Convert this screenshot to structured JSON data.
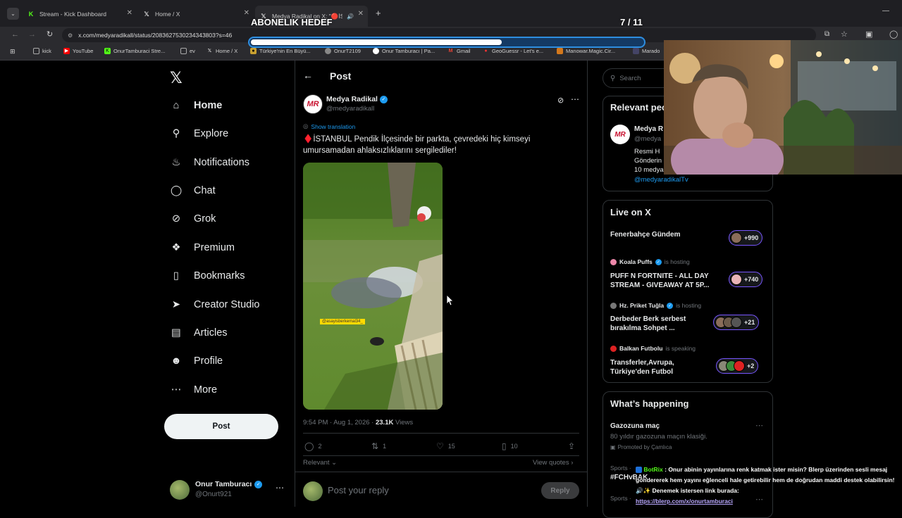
{
  "browser": {
    "tabs": [
      {
        "label": "Stream - Kick Dashboard",
        "icon": "kick-icon",
        "color": "#53fc18"
      },
      {
        "label": "Home / X",
        "icon": "x-logo-icon",
        "color": "#ffffff"
      },
      {
        "label": "Medya Radikal on X: \"🔴İST",
        "icon": "x-logo-icon",
        "color": "#ffffff"
      }
    ],
    "url": "x.com/medyaradikall/status/2083627530234343803?s=46",
    "bookmarks": [
      "kick",
      "YouTube",
      "OnurTamburaci Stre...",
      "ev",
      "Home / X",
      "Türkiye'nin En Büyü...",
      "OnurT2109",
      "Onur Tamburacı | Pa...",
      "Gmail",
      "GeoGuessr - Let's e...",
      "Manowar.Magic.Cir...",
      "Marado"
    ]
  },
  "overlay": {
    "goal_label": "ABONELIK HEDEF",
    "goal_count": "7 / 11",
    "goal_progress": 0.64
  },
  "nav": {
    "items": [
      {
        "label": "Home",
        "icon": "home-icon"
      },
      {
        "label": "Explore",
        "icon": "search-icon"
      },
      {
        "label": "Notifications",
        "icon": "bell-icon"
      },
      {
        "label": "Chat",
        "icon": "chat-icon"
      },
      {
        "label": "Grok",
        "icon": "grok-icon"
      },
      {
        "label": "Premium",
        "icon": "premium-icon"
      },
      {
        "label": "Bookmarks",
        "icon": "bookmark-icon"
      },
      {
        "label": "Creator Studio",
        "icon": "rocket-icon"
      },
      {
        "label": "Articles",
        "icon": "article-icon"
      },
      {
        "label": "Profile",
        "icon": "person-icon"
      },
      {
        "label": "More",
        "icon": "more-circle-icon"
      }
    ],
    "post_button": "Post",
    "account": {
      "name": "Onur Tamburacı",
      "handle": "@Onurt921"
    }
  },
  "main": {
    "header_title": "Post",
    "author": {
      "name": "Medya Radikal",
      "handle": "@medyaradikall",
      "avatar_text": "MR"
    },
    "show_translation": "Show translation",
    "text": "♦️İSTANBUL Pendik İlçesinde bir parkta, çevredeki hiç kimseyi umursamadan ahlaksızlıklarını sergilediler!",
    "media_watermark": "@asayisberkemal34_",
    "timestamp": "9:54 PM · Aug 1, 2026 · ",
    "views_count": "23.1K",
    "views_label": " Views",
    "stats": {
      "replies": "2",
      "reposts": "1",
      "likes": "15",
      "bookmarks": "10"
    },
    "relevant": "Relevant",
    "view_quotes": "View quotes",
    "reply_placeholder": "Post your reply",
    "reply_button": "Reply"
  },
  "right": {
    "search_placeholder": "Search",
    "relevant_title": "Relevant people",
    "relevant_person": {
      "name": "Medya R",
      "handle": "@medya",
      "bio_lines": [
        "Resmi H",
        "Gönderin",
        "10 medya"
      ],
      "link": "@medyaradikalTv"
    },
    "live_title": "Live on X",
    "live": [
      {
        "host": "",
        "status": "",
        "title": "Fenerbahçe Gündem",
        "count": "+990"
      },
      {
        "host": "Koala Puffs",
        "status": "is hosting",
        "title": "PUFF N FORTNITE - ALL DAY STREAM - GIVEAWAY AT 5P...",
        "count": "+740"
      },
      {
        "host": "Hz. Priket Tuğla",
        "status": "is hosting",
        "title": "Derbeder Berk serbest bırakılma Sohpet ...",
        "count": "+21"
      },
      {
        "host": "Balkan Futbolu",
        "status": "is speaking",
        "title": "Transferler,Avrupa, Türkiye'den Futbol",
        "count": "+2"
      }
    ],
    "happening_title": "What’s happening",
    "trend": {
      "title": "Gazozuna maç",
      "desc": "80 yıldır gazozuna maçın klasiği.",
      "promo": "Promoted by Çamlıca"
    },
    "sports1": "Sports ·",
    "tag1": "#FCHvBAK",
    "sports2": "Sports ·"
  },
  "chat": {
    "user": "BotRix",
    "message": " : Onur abinin yayınlarına renk katmak ister misin? Blerp üzerinden sesli mesaj göndererek hem yayını eğlenceli hale getirebilir hem de doğrudan maddi destek olabilirsin! 🔊✨ Denemek istersen link burada:",
    "link": "https://blerp.com/x/onurtamburaci"
  }
}
